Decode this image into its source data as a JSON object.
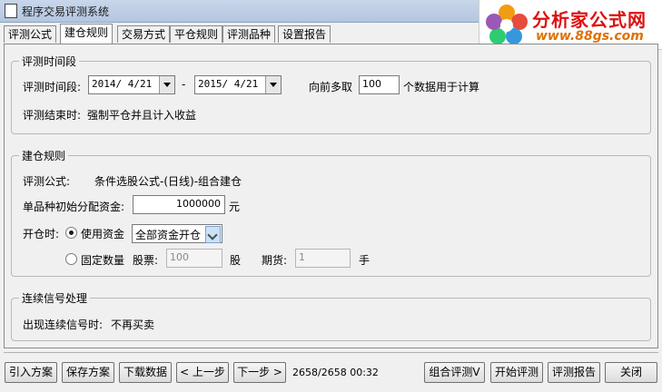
{
  "window": {
    "title": "程序交易评测系统"
  },
  "logo": {
    "text": "分析家公式网",
    "url": "www.88gs.com"
  },
  "tabs": [
    "评测公式",
    "建仓规则",
    "交易方式",
    "平仓规则",
    "评测品种",
    "设置报告"
  ],
  "period": {
    "legend": "评测时间段",
    "label": "评测时间段:",
    "start": "2014/ 4/21",
    "sep": "-",
    "end": "2015/ 4/21",
    "lookback_label": "向前多取",
    "lookback_value": "100",
    "lookback_suffix": "个数据用于计算",
    "end_label": "评测结束时:",
    "end_value": "强制平仓并且计入收益"
  },
  "build": {
    "legend": "建仓规则",
    "formula_label": "评测公式:",
    "formula_value": "条件选股公式-(日线)-组合建仓",
    "capital_label": "单品种初始分配资金:",
    "capital_value": "1000000",
    "capital_unit": "元",
    "open_label": "开仓时:",
    "use_funds_label": "使用资金",
    "use_funds_option": "全部资金开仓",
    "fixed_qty_label": "固定数量",
    "stock_label": "股票:",
    "stock_value": "100",
    "stock_unit": "股",
    "futures_label": "期货:",
    "futures_value": "1",
    "futures_unit": "手"
  },
  "signal": {
    "legend": "连续信号处理",
    "label": "出现连续信号时:",
    "value": "不再买卖"
  },
  "footer": {
    "import": "引入方案",
    "save": "保存方案",
    "download": "下载数据",
    "prev": "< 上一步",
    "next": "下一步 >",
    "status": "2658/2658 00:32",
    "combo": "组合评测V",
    "start": "开始评测",
    "report": "评测报告",
    "close": "关闭"
  }
}
